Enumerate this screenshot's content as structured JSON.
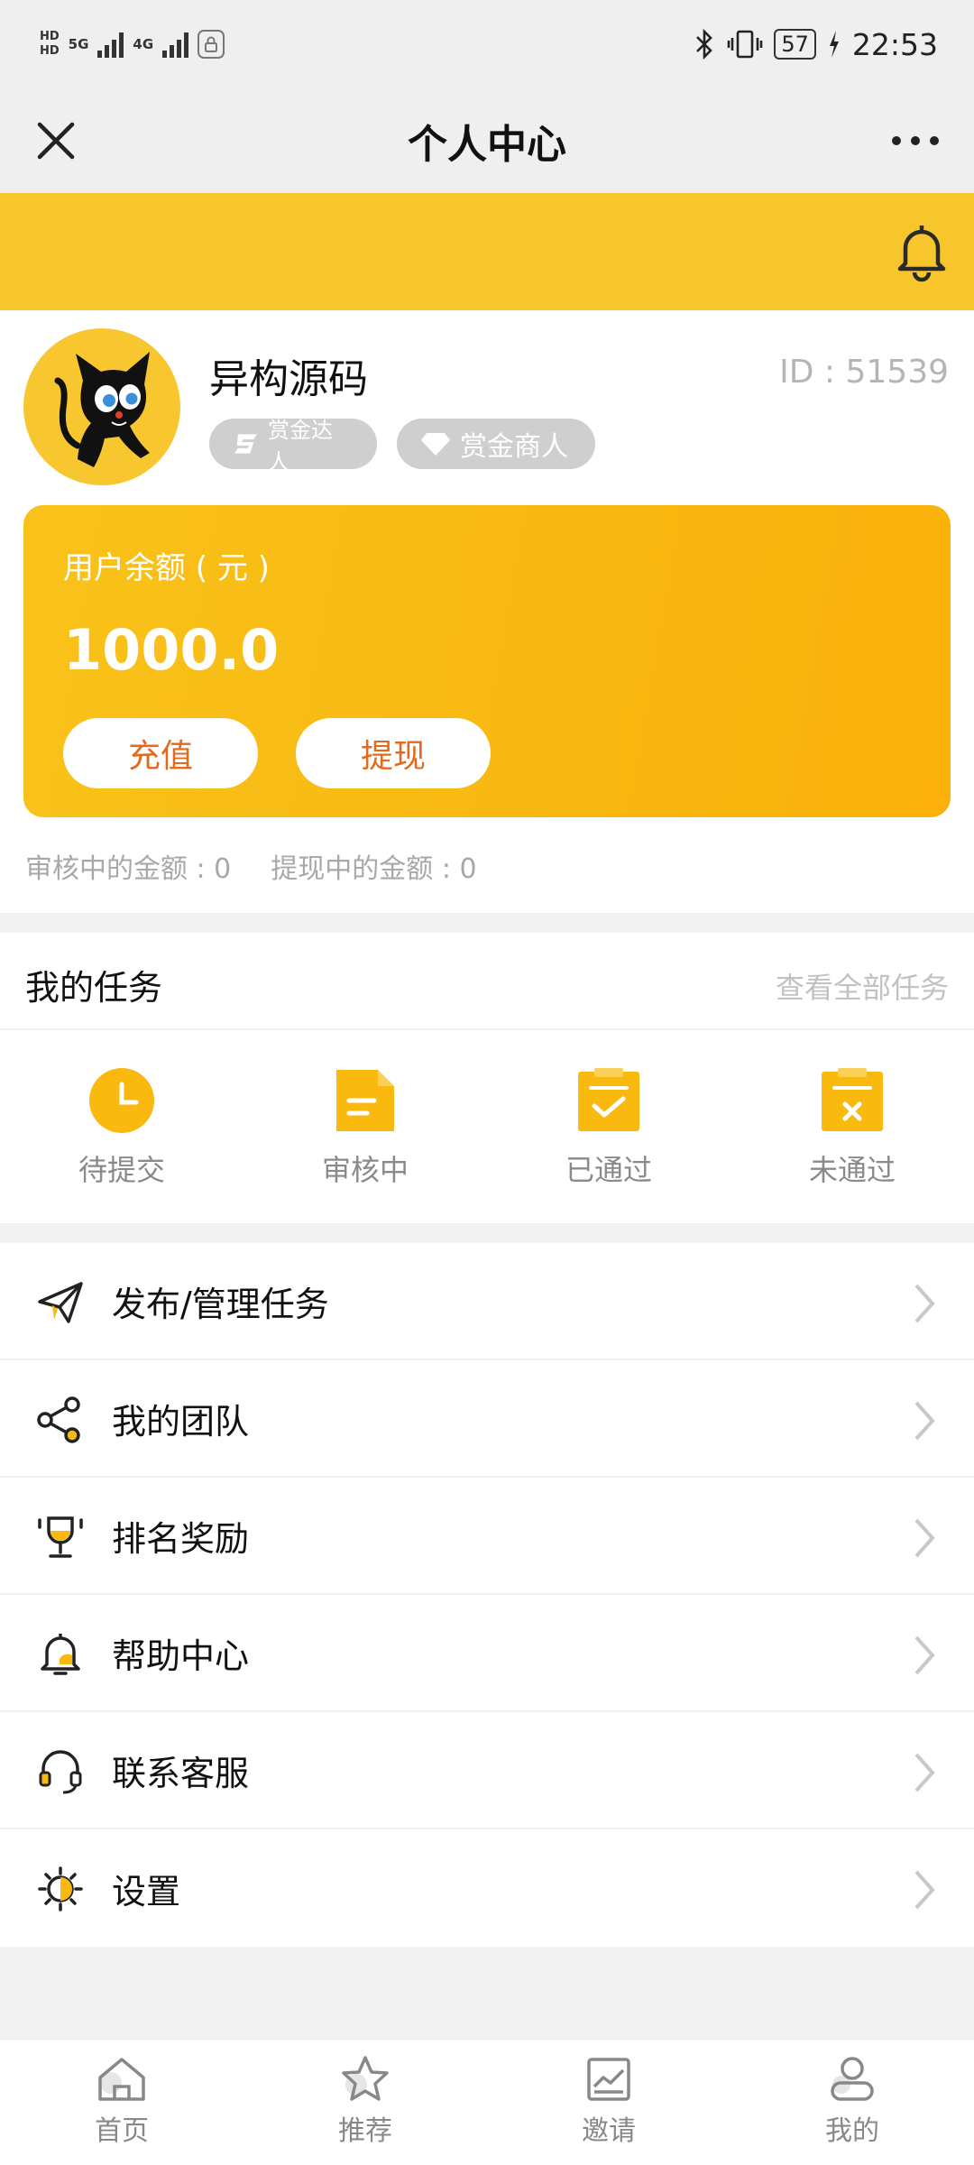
{
  "status_bar": {
    "net_top": "HD",
    "net_bottom": "HD",
    "net_5g": "5G",
    "net_4g": "4G",
    "battery": "57",
    "time": "22:53"
  },
  "title_bar": {
    "title": "个人中心"
  },
  "profile": {
    "name": "异构源码",
    "id_text": "ID : 51539",
    "badges": [
      {
        "label": "赏金达人",
        "icon": "s-logo-icon"
      },
      {
        "label": "赏金商人",
        "icon": "diamond-icon"
      }
    ]
  },
  "balance": {
    "label": "用户余额 ( 元 )",
    "amount": "1000.00",
    "recharge_label": "充值",
    "withdraw_label": "提现",
    "reviewing_text": "审核中的金额 : 0",
    "withdrawing_text": "提现中的金额 : 0"
  },
  "tasks": {
    "title": "我的任务",
    "view_all": "查看全部任务",
    "items": [
      {
        "label": "待提交",
        "icon": "clock-icon"
      },
      {
        "label": "审核中",
        "icon": "document-icon"
      },
      {
        "label": "已通过",
        "icon": "clipboard-check-icon"
      },
      {
        "label": "未通过",
        "icon": "clipboard-x-icon"
      }
    ]
  },
  "menu": {
    "items": [
      {
        "label": "发布/管理任务",
        "icon": "paper-plane-icon"
      },
      {
        "label": "我的团队",
        "icon": "share-nodes-icon"
      },
      {
        "label": "排名奖励",
        "icon": "trophy-icon"
      },
      {
        "label": "帮助中心",
        "icon": "bell-icon"
      },
      {
        "label": "联系客服",
        "icon": "headset-icon"
      },
      {
        "label": "设置",
        "icon": "gear-icon"
      }
    ]
  },
  "bottom_nav": {
    "items": [
      {
        "label": "首页",
        "icon": "home-icon"
      },
      {
        "label": "推荐",
        "icon": "star-icon"
      },
      {
        "label": "邀请",
        "icon": "chart-icon"
      },
      {
        "label": "我的",
        "icon": "user-icon"
      }
    ]
  },
  "colors": {
    "accent": "#f7c52c",
    "card_gradient_start": "#f9c21a",
    "card_gradient_end": "#fbb00b",
    "button_text": "#e26a1c",
    "badge_bg": "#cfcfcf"
  }
}
